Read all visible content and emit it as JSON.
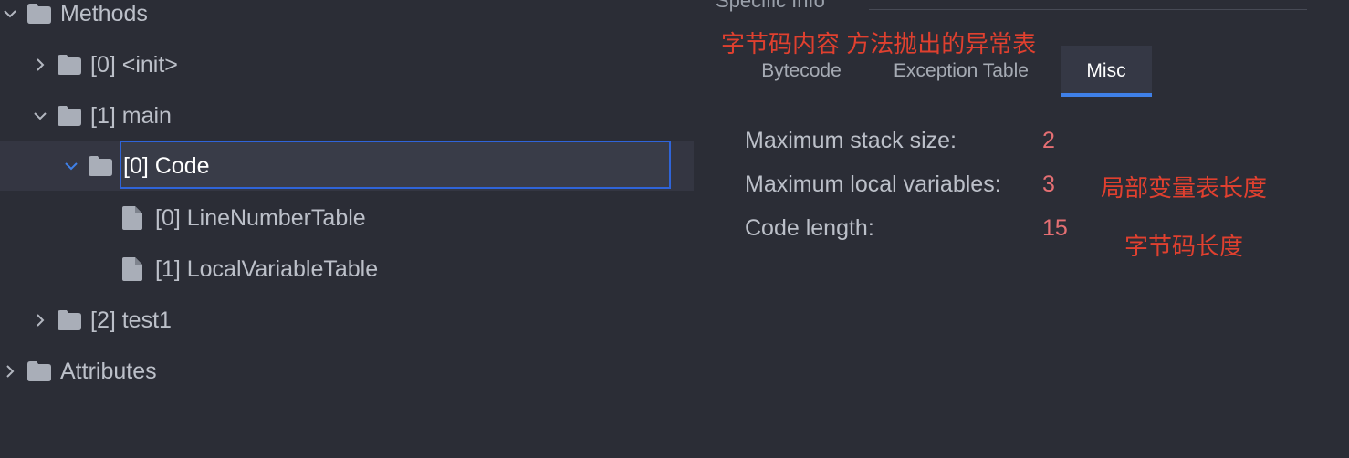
{
  "tree": {
    "methods": "Methods",
    "init": "[0] <init>",
    "main": "[1] main",
    "code": "[0] Code",
    "line_number_table": "[0] LineNumberTable",
    "local_variable_table": "[1] LocalVariableTable",
    "test1": "[2] test1",
    "attributes": "Attributes"
  },
  "panel": {
    "specific_info": "Specific Info",
    "annotation_tabs": "字节码内容 方法抛出的异常表",
    "tabs": [
      "Bytecode",
      "Exception Table",
      "Misc"
    ],
    "active_tab": "Misc",
    "fields": [
      {
        "label": "Maximum stack size:",
        "value": "2"
      },
      {
        "label": "Maximum local variables:",
        "value": "3"
      },
      {
        "label": "Code length:",
        "value": "15"
      }
    ],
    "annotation_locals": "局部变量表长度",
    "annotation_code_length": "字节码长度"
  },
  "colors": {
    "background": "#2b2d36",
    "selection_border": "#2f64d8",
    "accent": "#3f80e8",
    "annotation_red": "#e0402f",
    "value_pink": "#e56f73"
  },
  "icons": [
    "chevron-down-icon",
    "chevron-right-icon",
    "folder-icon",
    "file-icon"
  ]
}
